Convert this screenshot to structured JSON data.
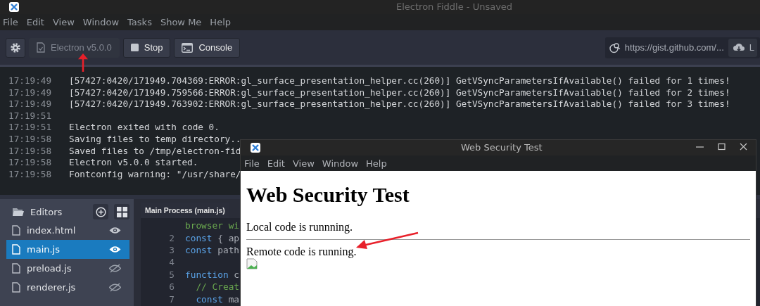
{
  "app_window": {
    "title": "Electron Fiddle - Unsaved"
  },
  "menu": [
    "File",
    "Edit",
    "View",
    "Window",
    "Tasks",
    "Show Me",
    "Help"
  ],
  "toolbar": {
    "version": {
      "label": "Electron v5.0.0",
      "disabled": true
    },
    "buttons": [
      {
        "kind": "stop",
        "label": "Stop"
      },
      {
        "kind": "console",
        "label": "Console"
      }
    ],
    "gist_field": {
      "value": "https://gist.github.com/..."
    },
    "load_button": {
      "label": "L"
    }
  },
  "console": {
    "lines": [
      {
        "time": "17:19:49",
        "message": "[57427:0420/171949.704369:ERROR:gl_surface_presentation_helper.cc(260)] GetVSyncParametersIfAvailable() failed for 1 times!"
      },
      {
        "time": "17:19:49",
        "message": "[57427:0420/171949.759566:ERROR:gl_surface_presentation_helper.cc(260)] GetVSyncParametersIfAvailable() failed for 2 times!"
      },
      {
        "time": "17:19:49",
        "message": "[57427:0420/171949.763902:ERROR:gl_surface_presentation_helper.cc(260)] GetVSyncParametersIfAvailable() failed for 3 times!"
      },
      {
        "time": "17:19:51"
      },
      {
        "time": "17:19:51",
        "message": "Electron exited with code 0."
      },
      {
        "time": "17:19:58",
        "message": "Saving files to temp directory.."
      },
      {
        "time": "17:19:58",
        "message": "Saved files to /tmp/electron-fid"
      },
      {
        "time": "17:19:58",
        "message": "Electron v5.0.0 started."
      },
      {
        "time": "17:19:58",
        "message": "Fontconfig warning: \"/usr/share/"
      }
    ]
  },
  "sidebar": {
    "title": "Editors",
    "files": [
      {
        "name": "index.html",
        "selected": false,
        "visible": true
      },
      {
        "name": "main.js",
        "selected": true,
        "visible": true
      },
      {
        "name": "preload.js",
        "selected": false,
        "visible": false
      },
      {
        "name": "renderer.js",
        "selected": false,
        "visible": false
      }
    ]
  },
  "editor": {
    "tab": "Main Process (main.js)",
    "lines": [
      {
        "tokens": [
          {
            "kind": "comment",
            "text": "browser wi"
          }
        ]
      },
      {
        "number": "2",
        "tokens": [
          {
            "kind": "keyword",
            "text": "const"
          },
          {
            "kind": "plain",
            "text": " { ap"
          }
        ]
      },
      {
        "number": "3",
        "tokens": [
          {
            "kind": "keyword",
            "text": "const"
          },
          {
            "kind": "plain",
            "text": " path"
          }
        ]
      },
      {
        "number": "4"
      },
      {
        "number": "5",
        "tokens": [
          {
            "kind": "keyword",
            "text": "function"
          },
          {
            "kind": "plain",
            "text": " c"
          }
        ]
      },
      {
        "number": "6",
        "tokens": [
          {
            "kind": "comment",
            "text": "  // Creat"
          }
        ]
      },
      {
        "number": "7",
        "tokens": [
          {
            "kind": "keyword",
            "text": "  const"
          },
          {
            "kind": "plain",
            "text": " ma"
          }
        ]
      }
    ]
  },
  "popup_window": {
    "title": "Web Security Test",
    "menu": [
      "File",
      "Edit",
      "View",
      "Window",
      "Help"
    ],
    "heading": "Web Security Test",
    "paragraphs": [
      "Local code is runnning.",
      "Remote code is running."
    ]
  }
}
